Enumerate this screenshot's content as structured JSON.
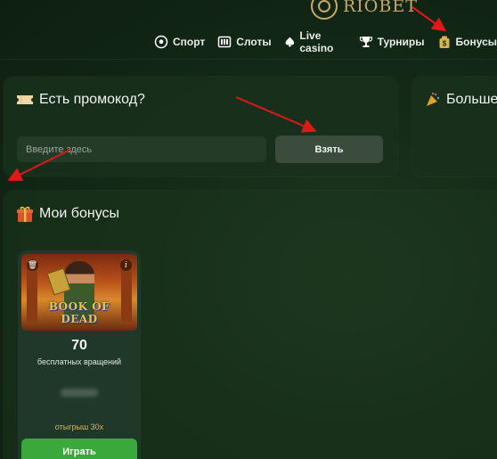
{
  "header": {
    "logo_text": "RIOBET",
    "nav": [
      {
        "label": "Спорт",
        "icon": "soccer-ball-icon"
      },
      {
        "label": "Слоты",
        "icon": "slot-machine-icon"
      },
      {
        "label": "Live casino",
        "icon": "live-casino-icon"
      },
      {
        "label": "Турниры",
        "icon": "trophy-icon"
      },
      {
        "label": "Бонусы",
        "icon": "money-bag-icon",
        "active": true
      }
    ]
  },
  "promo": {
    "title": "Есть промокод?",
    "input_placeholder": "Введите здесь",
    "button_label": "Взять"
  },
  "more": {
    "title": "Больше"
  },
  "bonuses": {
    "title": "Мои бонусы",
    "cards": [
      {
        "game_logo_text": "BOOK OF DEAD",
        "amount": "70",
        "description": "бесплатных вращений",
        "wager": "отыгрыш 30х",
        "play_label": "Играть"
      }
    ]
  },
  "colors": {
    "accent_green": "#3aa83a",
    "brand_gold": "#c8a86a",
    "annotation_red": "#e01818"
  }
}
